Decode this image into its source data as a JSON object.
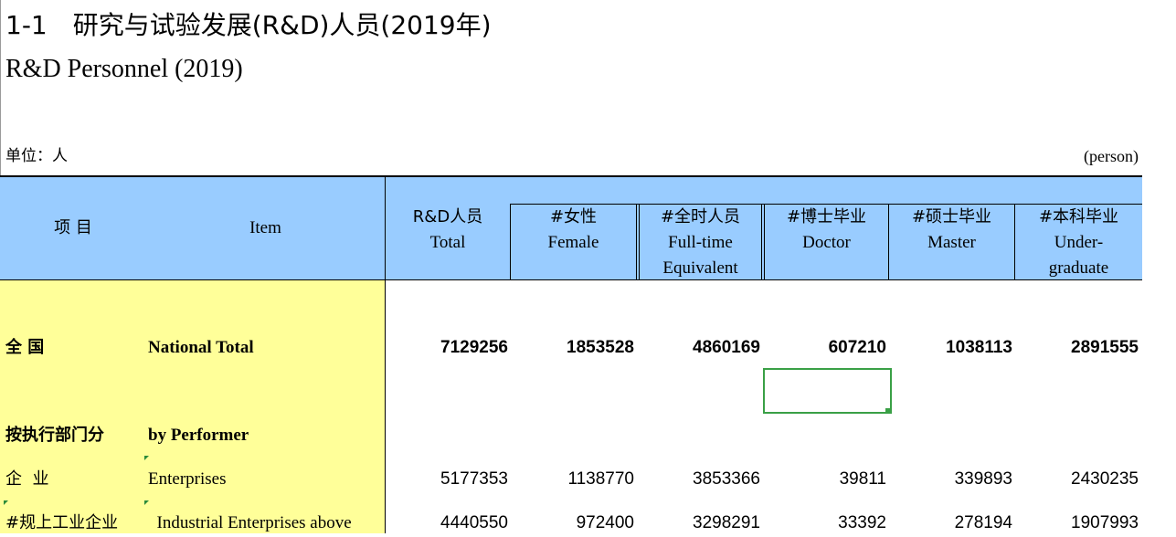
{
  "title_cn": "1-1　研究与试验发展(R&D)人员(2019年)",
  "title_en": "R&D Personnel (2019)",
  "unit_left": "单位：人",
  "unit_right": "(person)",
  "header": {
    "item_cn": "项  目",
    "item_en": "Item",
    "columns": [
      {
        "cn": "R&D人员",
        "en1": "Total",
        "en2": ""
      },
      {
        "cn": "#女性",
        "en1": "Female",
        "en2": ""
      },
      {
        "cn": "#全时人员",
        "en1": "Full-time",
        "en2": "Equivalent"
      },
      {
        "cn": "#博士毕业",
        "en1": "Doctor",
        "en2": ""
      },
      {
        "cn": "#硕士毕业",
        "en1": "Master",
        "en2": ""
      },
      {
        "cn": "#本科毕业",
        "en1": "Under-",
        "en2": "graduate"
      }
    ]
  },
  "rows": [
    {
      "cn": "全 国",
      "en": "National Total",
      "values": [
        "7129256",
        "1853528",
        "4860169",
        "607210",
        "1038113",
        "2891555"
      ]
    },
    {
      "cn": "按执行部门分",
      "en": "by Performer",
      "values": [
        "",
        "",
        "",
        "",
        "",
        ""
      ]
    },
    {
      "cn": "企  业",
      "en": "Enterprises",
      "values": [
        "5177353",
        "1138770",
        "3853366",
        "39811",
        "339893",
        "2430235"
      ]
    },
    {
      "cn": "#规上工业企业",
      "en": "  Industrial Enterprises above",
      "values": [
        "4440550",
        "972400",
        "3298291",
        "33392",
        "278194",
        "1907993"
      ]
    }
  ]
}
